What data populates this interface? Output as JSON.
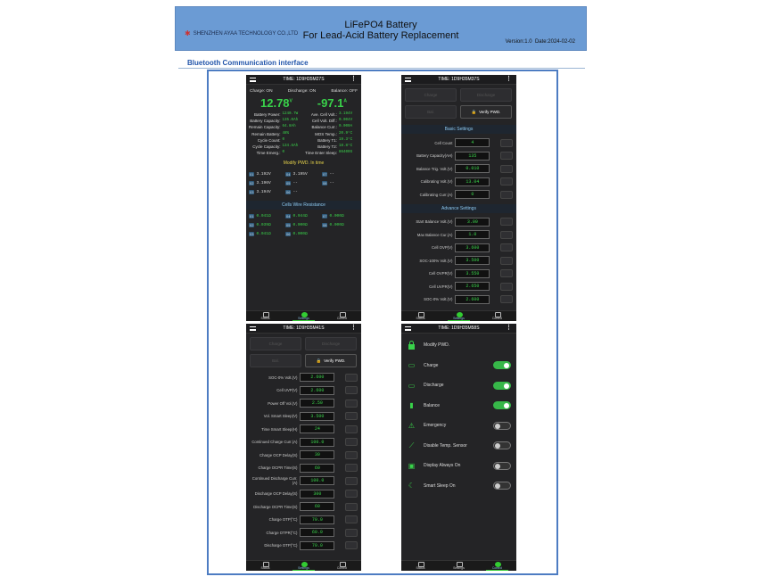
{
  "header": {
    "company": "SHENZHEN AYAA TECHNOLOGY CO.,LTD",
    "title_line1": "LiFePO4 Battery",
    "title_line2": "For Lead-Acid Battery Replacement",
    "version": "Version:1.0",
    "date": "Date:2024-02-02"
  },
  "section_title": "Bluetooth Communication interface",
  "nav": {
    "status": "Status",
    "settings": "Settings",
    "control": "Control"
  },
  "screen1": {
    "time": "TIME: 1D9H35M27S",
    "charge": "Charge: ON",
    "discharge": "Discharge: ON",
    "balance": "Balance: OFF",
    "voltage": "12.78",
    "voltage_unit": "V",
    "current": "-97.1",
    "current_unit": "A",
    "left": [
      [
        "Battery Power:",
        "1240.7W"
      ],
      [
        "Battery Capacity:",
        "135.0Ah"
      ],
      [
        "Remain Capacity:",
        "64.8Ah"
      ],
      [
        "Remain Battery:",
        "48%"
      ],
      [
        "Cycle Count:",
        "0"
      ],
      [
        "Cycle Capacity:",
        "134.6Ah"
      ],
      [
        "Time Emerg.:",
        "0"
      ]
    ],
    "right": [
      [
        "Ave. Cell Volt.:",
        "3.194V"
      ],
      [
        "Cell Volt. Diff.:",
        "0.004V"
      ],
      [
        "Balance Curr.:",
        "0.000A"
      ],
      [
        "MOS Temp.:",
        "20.9°C"
      ],
      [
        "Battery T1:",
        "19.3°C"
      ],
      [
        "Battery T2:",
        "18.8°C"
      ],
      [
        "Time Enter Sleep:",
        "86400S"
      ]
    ],
    "modify_pwd": "Modify PWD. In time",
    "cells": [
      [
        "01",
        "3.192V"
      ],
      [
        "04",
        "3.195V"
      ],
      [
        "07",
        "--"
      ],
      [
        "02",
        "3.196V"
      ],
      [
        "05",
        "--"
      ],
      [
        "08",
        "--"
      ],
      [
        "03",
        "3.194V"
      ],
      [
        "06",
        "--"
      ],
      [
        "",
        ""
      ]
    ],
    "wire_title": "Cells Wire Resistance",
    "wires": [
      [
        "01",
        "0.041Ω"
      ],
      [
        "04",
        "0.044Ω"
      ],
      [
        "07",
        "0.000Ω"
      ],
      [
        "02",
        "0.039Ω"
      ],
      [
        "05",
        "0.000Ω"
      ],
      [
        "08",
        "0.000Ω"
      ],
      [
        "03",
        "0.041Ω"
      ],
      [
        "06",
        "0.000Ω"
      ],
      [
        "",
        ""
      ]
    ]
  },
  "screen2": {
    "time": "TIME: 1D9H35M37S",
    "buttons": [
      "Charge",
      "Discharge",
      "Bal.",
      "Verify PWD."
    ],
    "basic_title": "Basic Settings",
    "basic": [
      [
        "Cell Count",
        "4"
      ],
      [
        "Battery Capacity(AH)",
        "135"
      ],
      [
        "Balance Trig. Volt.(V)",
        "0.010"
      ],
      [
        "Calibrating Volt.(V)",
        "13.04"
      ],
      [
        "Calibrating Curr.(A)",
        "0"
      ]
    ],
    "adv_title": "Advance Settings",
    "adv": [
      [
        "Start Balance Volt.(V)",
        "3.00"
      ],
      [
        "Max Balance Cur.(A)",
        "1.0"
      ],
      [
        "Cell OVP(V)",
        "3.600"
      ],
      [
        "SOC-100% Volt.(V)",
        "3.500"
      ],
      [
        "Cell OVPR(V)",
        "3.550"
      ],
      [
        "Cell UVPR(V)",
        "2.650"
      ],
      [
        "SOC-0% Volt.(V)",
        "2.600"
      ]
    ]
  },
  "screen3": {
    "time": "TIME: 1D9H35M41S",
    "buttons": [
      "Charge",
      "Discharge",
      "Bal.",
      "Verify PWD."
    ],
    "rows": [
      [
        "SOC-0% Volt.(V)",
        "2.600"
      ],
      [
        "Cell UVP(V)",
        "2.600"
      ],
      [
        "Power Off Vol.(V)",
        "2.50"
      ],
      [
        "Vol. Smart Sleep(V)",
        "3.500"
      ],
      [
        "Time Smart Sleep(H)",
        "24"
      ],
      [
        "Continued Charge Curr.(A)",
        "100.0"
      ],
      [
        "Charge OCP Delay(S)",
        "30"
      ],
      [
        "Charge OCPR Time(S)",
        "60"
      ],
      [
        "Continued Discharge Curr.(A)",
        "100.0"
      ],
      [
        "Discharge OCP Delay(S)",
        "300"
      ],
      [
        "Discharge OCPR Time(S)",
        "60"
      ],
      [
        "Charge OTP(°C)",
        "70.0"
      ],
      [
        "Charge OTPR(°C)",
        "60.0"
      ],
      [
        "Discharge OTP(°C)",
        "70.0"
      ]
    ]
  },
  "screen4": {
    "time": "TIME: 1D9H35M58S",
    "modify": "Modify PWD.",
    "toggles": [
      [
        "Charge",
        "on"
      ],
      [
        "Discharge",
        "on"
      ],
      [
        "Balance",
        "on"
      ],
      [
        "Emergency",
        "off"
      ],
      [
        "Disable Temp. Sensor",
        "off"
      ],
      [
        "Display Always On",
        "off"
      ],
      [
        "Smart Sleep On",
        "off"
      ]
    ]
  },
  "colors": {
    "header_bg": "#6b9bd4",
    "frame": "#4d7cc2",
    "phone_bg": "#242426",
    "green": "#39d24a",
    "toggle_on": "#37b749"
  }
}
